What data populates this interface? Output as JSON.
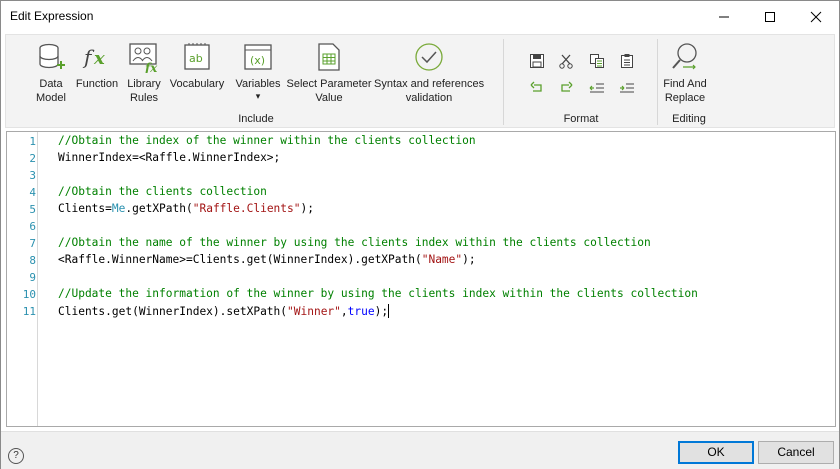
{
  "window": {
    "title": "Edit Expression"
  },
  "ribbon": {
    "include": {
      "label": "Include",
      "buttons": [
        {
          "label1": "Data",
          "label2": "Model"
        },
        {
          "label1": "Function",
          "label2": ""
        },
        {
          "label1": "Library",
          "label2": "Rules"
        },
        {
          "label1": "Vocabulary",
          "label2": ""
        },
        {
          "label1": "Variables",
          "label2": "▾"
        },
        {
          "label1": "Select Parameter",
          "label2": "Value"
        },
        {
          "label1": "Syntax and references",
          "label2": "validation"
        }
      ]
    },
    "format": {
      "label": "Format"
    },
    "editing": {
      "label": "Editing",
      "find_label1": "Find And",
      "find_label2": "Replace"
    }
  },
  "editor": {
    "line_numbers": [
      "1",
      "2",
      "3",
      "4",
      "5",
      "6",
      "7",
      "8",
      "9",
      "10",
      "11"
    ],
    "lines": [
      "//Obtain the index of the winner within the clients collection",
      "WinnerIndex=<Raffle.WinnerIndex>;",
      "",
      "//Obtain the clients collection",
      "Clients=Me.getXPath(\"Raffle.Clients\");",
      "",
      "//Obtain the name of the winner by using the clients index within the clients collection",
      "<Raffle.WinnerName>=Clients.get(WinnerIndex).getXPath(\"Name\");",
      "",
      "//Update the information of the winner by using the clients index within the clients collection",
      "Clients.get(WinnerIndex).setXPath(\"Winner\",true);"
    ]
  },
  "footer": {
    "help": "?",
    "ok_label": "OK",
    "cancel_label": "Cancel"
  },
  "colors": {
    "comment": "#008000",
    "string": "#a31515",
    "keyword": "#0000ff",
    "type": "#2b91af",
    "line_number": "#2b91af",
    "accent": "#0078d7"
  }
}
